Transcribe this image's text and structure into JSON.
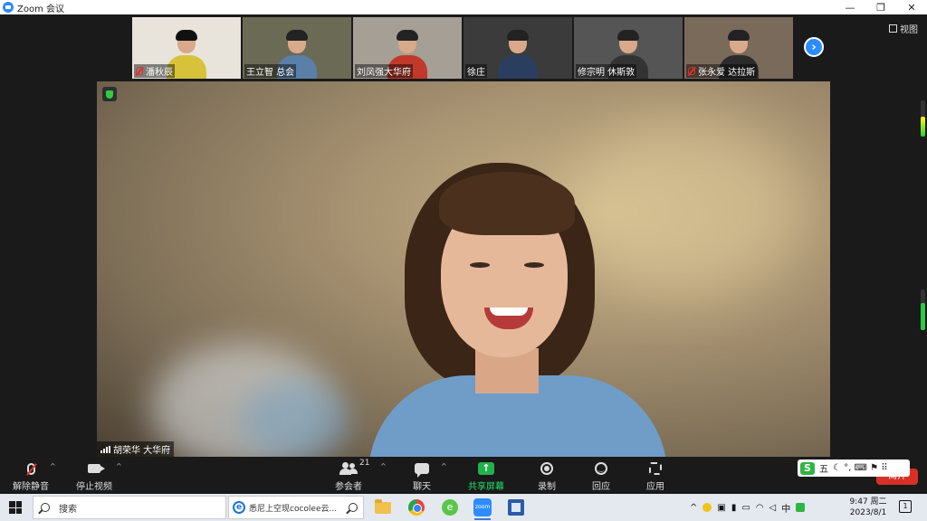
{
  "window": {
    "title": "Zoom 会议",
    "minimize": "—",
    "restore": "❐",
    "close": "✕"
  },
  "view_label": "视图",
  "participants": [
    {
      "name": "潘秋辰",
      "muted": true,
      "bg": "#e8e4dc",
      "body": "#d7c33a",
      "hair": "#111"
    },
    {
      "name": "王立智 总会",
      "muted": false,
      "bg": "#6b6a55",
      "body": "#5a7fa8",
      "hair": "#222"
    },
    {
      "name": "刘凤强大华府",
      "muted": false,
      "bg": "#a69f95",
      "body": "#c0392b",
      "hair": "#222"
    },
    {
      "name": "徐庄",
      "muted": false,
      "bg": "#3b3b3b",
      "body": "#2c3e60",
      "hair": "#222"
    },
    {
      "name": "修宗明 休斯敦",
      "muted": false,
      "bg": "#555",
      "body": "#333",
      "hair": "#222"
    },
    {
      "name": "张永爱 达拉斯",
      "muted": true,
      "bg": "#7a6a5a",
      "body": "#2b2b2b",
      "hair": "#222"
    }
  ],
  "next_arrow": "›",
  "speaker": {
    "name": "胡荣华 大华府"
  },
  "toolbar": {
    "unmute": "解除静音",
    "stop_video": "停止视频",
    "participants": "参会者",
    "participant_count": "21",
    "chat": "聊天",
    "share": "共享屏幕",
    "record": "录制",
    "reactions": "回应",
    "apps": "应用",
    "leave": "离开"
  },
  "ime": {
    "logo": "S",
    "mode": "五",
    "extras": "☾ °, ⌨ ⚑ ⠿"
  },
  "taskbar": {
    "search": "搜索",
    "browser_tab": "悉尼上空现cocolee云...",
    "zoom_text": "zoom",
    "tray_lang": "中",
    "time": "9:47 周二",
    "date": "2023/8/1",
    "notifications": "1"
  }
}
